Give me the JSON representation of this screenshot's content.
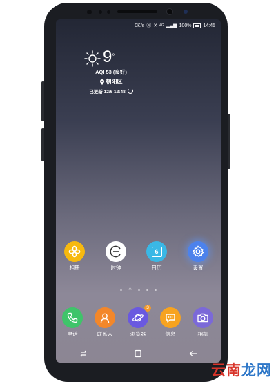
{
  "status_bar": {
    "net_speed": "0K/s",
    "battery": "100%",
    "time": "14:45"
  },
  "weather": {
    "temp": "9",
    "degree": "°",
    "aqi": "AQI 53 (良好)",
    "location": "朝阳区",
    "updated": "已更新 12/6 12:48"
  },
  "apps": [
    {
      "label": "相册",
      "icon": "gallery-flower-icon",
      "color": "#f7b90f"
    },
    {
      "label": "时钟",
      "icon": "clock-icon",
      "color": "#ffffff"
    },
    {
      "label": "日历",
      "icon": "calendar-icon",
      "color": "#3ab8e6",
      "day": "6"
    },
    {
      "label": "设置",
      "icon": "gear-icon",
      "color": "#4c82ec"
    }
  ],
  "dock": [
    {
      "label": "电话",
      "icon": "phone-icon",
      "color": "#3fc46a"
    },
    {
      "label": "联系人",
      "icon": "contacts-icon",
      "color": "#f3872a"
    },
    {
      "label": "浏览器",
      "icon": "browser-planet-icon",
      "color": "#6a59e0",
      "badge": "3"
    },
    {
      "label": "信息",
      "icon": "message-icon",
      "color": "#f7a31f"
    },
    {
      "label": "相机",
      "icon": "camera-icon",
      "color": "#7b69d8"
    }
  ],
  "watermark": {
    "part_a": "云南",
    "part_b": "龙网"
  }
}
